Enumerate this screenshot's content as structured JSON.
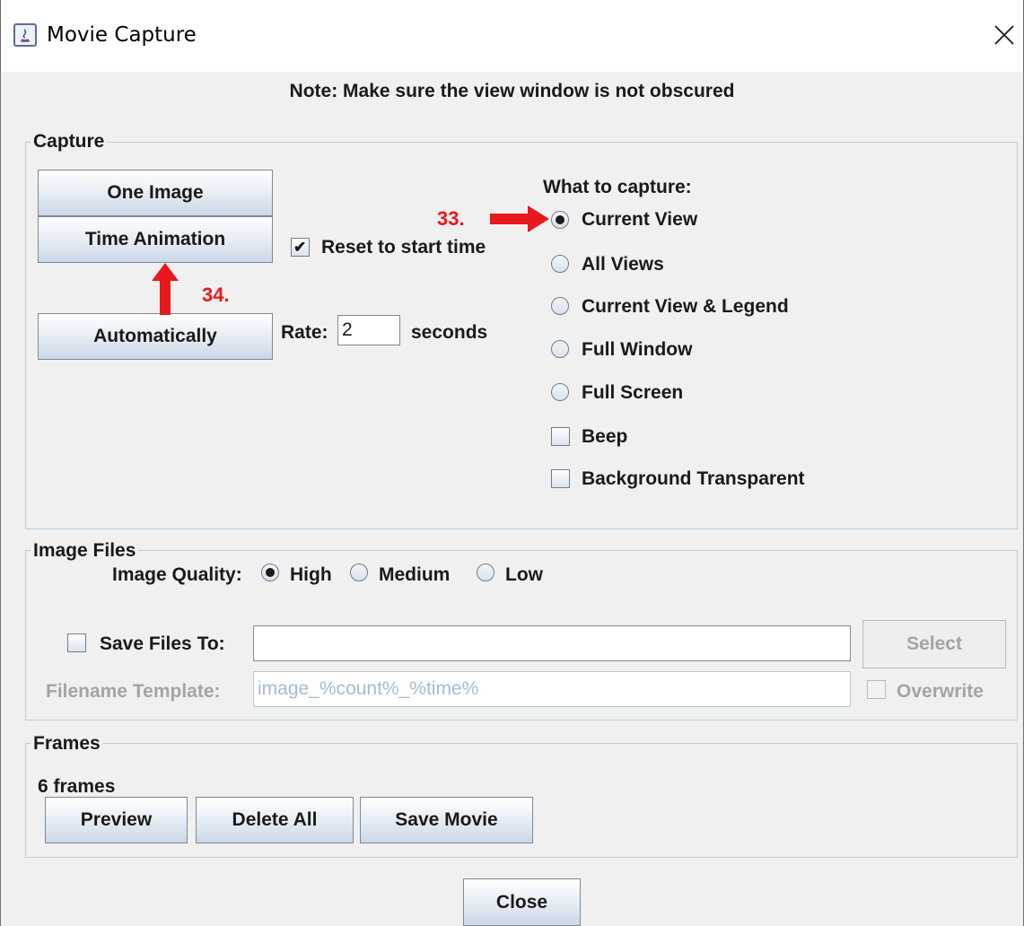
{
  "window": {
    "title": "Movie Capture",
    "note": "Note: Make sure the view window is not obscured"
  },
  "capture": {
    "group_title": "Capture",
    "one_image_label": "One Image",
    "time_animation_label": "Time Animation",
    "automatically_label": "Automatically",
    "reset_checkbox": {
      "label": "Reset to start time",
      "checked": true
    },
    "rate_label": "Rate:",
    "rate_value": "2",
    "seconds_label": "seconds",
    "what_to_capture_label": "What to capture:",
    "options": [
      {
        "label": "Current View",
        "selected": true
      },
      {
        "label": "All Views",
        "selected": false
      },
      {
        "label": "Current View & Legend",
        "selected": false
      },
      {
        "label": "Full Window",
        "selected": false
      },
      {
        "label": "Full Screen",
        "selected": false
      }
    ],
    "beep": {
      "label": "Beep",
      "checked": false
    },
    "background_transparent": {
      "label": "Background Transparent",
      "checked": false
    }
  },
  "annotations": {
    "step_33": "33.",
    "step_34": "34.",
    "color": "#e8191c"
  },
  "image_files": {
    "group_title": "Image Files",
    "quality_label": "Image Quality:",
    "quality_options": [
      {
        "label": "High",
        "selected": true
      },
      {
        "label": "Medium",
        "selected": false
      },
      {
        "label": "Low",
        "selected": false
      }
    ],
    "save_files_to": {
      "label": "Save Files To:",
      "checked": false,
      "value": ""
    },
    "select_label": "Select",
    "filename_template_label": "Filename Template:",
    "filename_template_placeholder": "image_%count%_%time%",
    "overwrite": {
      "label": "Overwrite",
      "checked": false
    }
  },
  "frames": {
    "group_title": "Frames",
    "count_text": "6 frames",
    "preview_label": "Preview",
    "delete_all_label": "Delete All",
    "save_movie_label": "Save Movie"
  },
  "close_label": "Close"
}
